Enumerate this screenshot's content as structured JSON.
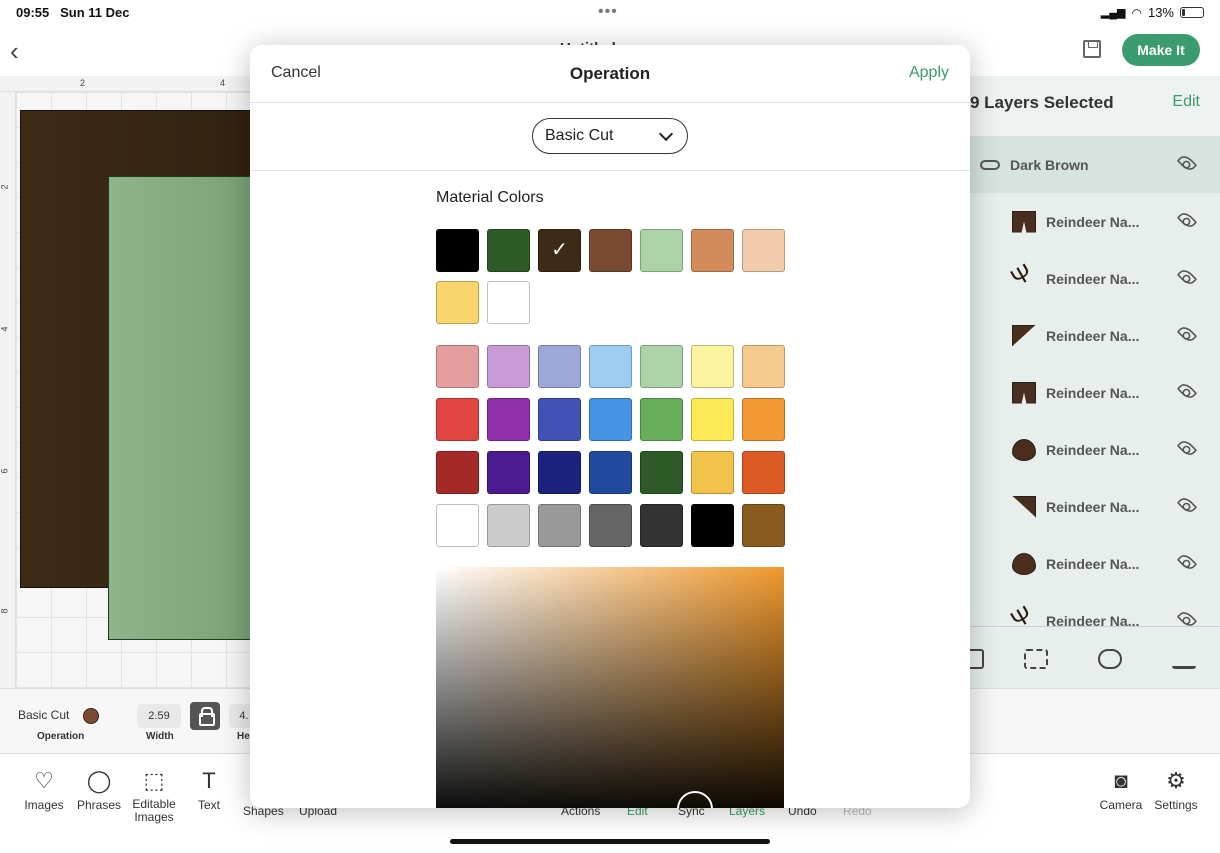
{
  "status": {
    "time": "09:55",
    "date": "Sun 11 Dec",
    "battery": "13%",
    "signal_icon": "signal-icon",
    "wifi_icon": "wifi-icon"
  },
  "topbar": {
    "title": "Untitled",
    "make_it": "Make It"
  },
  "ruler": {
    "top": [
      "2",
      "4"
    ],
    "left": [
      "2",
      "4",
      "6",
      "8"
    ]
  },
  "layers": {
    "title": "9 Layers Selected",
    "edit": "Edit",
    "group": "Dark Brown",
    "items": [
      {
        "label": "Reindeer Na...",
        "shape": "pants"
      },
      {
        "label": "Reindeer Na...",
        "shape": "antler"
      },
      {
        "label": "Reindeer Na...",
        "shape": "tri"
      },
      {
        "label": "Reindeer Na...",
        "shape": "pants"
      },
      {
        "label": "Reindeer Na...",
        "shape": "drop"
      },
      {
        "label": "Reindeer Na...",
        "shape": "tri2"
      },
      {
        "label": "Reindeer Na...",
        "shape": "drop"
      },
      {
        "label": "Reindeer Na...",
        "shape": "antler"
      }
    ]
  },
  "props": {
    "operation": "Basic Cut",
    "operation_caption": "Operation",
    "width_value": "2.59",
    "width_caption": "Width",
    "height_value": "4.",
    "height_caption": "Hei"
  },
  "bottom_tools": {
    "images": "Images",
    "phrases": "Phrases",
    "editable_images": "Editable Images",
    "text": "Text",
    "shapes": "Shapes",
    "upload": "Upload",
    "actions": "Actions",
    "edit": "Edit",
    "sync": "Sync",
    "layers": "Layers",
    "undo": "Undo",
    "redo": "Redo",
    "camera": "Camera",
    "settings": "Settings"
  },
  "modal": {
    "cancel": "Cancel",
    "title": "Operation",
    "apply": "Apply",
    "operation_select": "Basic Cut",
    "material_colors_title": "Material Colors",
    "material_colors": [
      "#000000",
      "#2d5a27",
      "#3e2b16",
      "#7b4a32",
      "#acd3a8",
      "#d48b5c",
      "#f2ccaa",
      "#f8d66d",
      "#ffffff"
    ],
    "selected_index": 2,
    "palette": [
      [
        "#e59e9e",
        "#c99ad8",
        "#9ea8d8",
        "#9ecbf2",
        "#acd3a8",
        "#fbf39e",
        "#f6ca8c"
      ],
      [
        "#e0463f",
        "#8e30aa",
        "#4252b4",
        "#4594e8",
        "#66ae5a",
        "#fbe955",
        "#f39a35"
      ],
      [
        "#a52a27",
        "#4a1a8e",
        "#1c237e",
        "#1f4a9e",
        "#2d5a27",
        "#f2c34a",
        "#de5a24"
      ],
      [
        "#ffffff",
        "#cccccc",
        "#999999",
        "#666666",
        "#333333",
        "#000000",
        "#8a5a1e"
      ]
    ],
    "picker_color": "#f0982c"
  }
}
